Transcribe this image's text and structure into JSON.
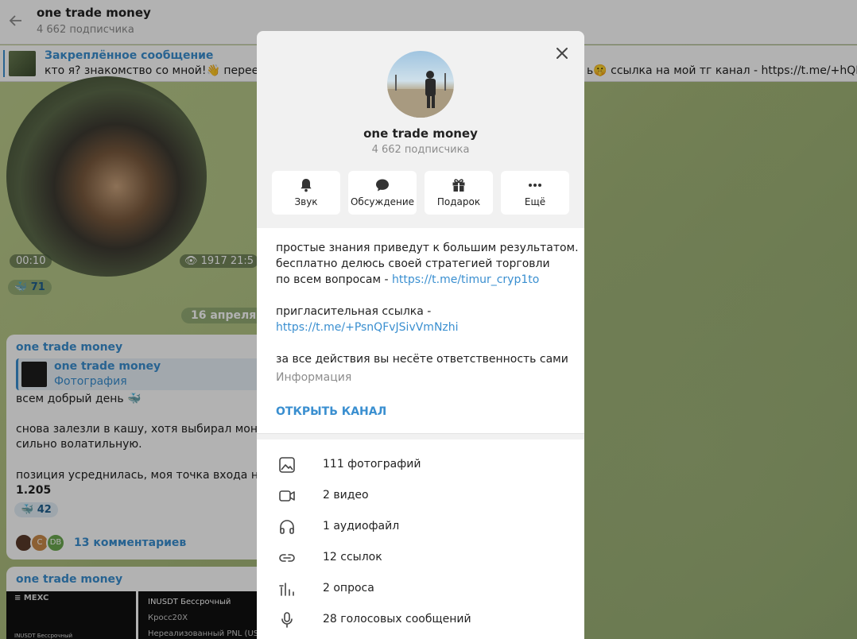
{
  "header": {
    "title": "one trade money",
    "subtitle": "4 662 подписчика"
  },
  "pinned": {
    "title": "Закреплённое сообщение",
    "text": "кто я? знакомство со мной!👋  переезд",
    "text_right": "ь🤫  ссылка на мой тг канал - https://t.me/+hQPxS"
  },
  "chat": {
    "video_time": "00:10",
    "video_views": "👁 1917  21:5",
    "reaction_1": "🐳 71",
    "date_pill": "16 апреля",
    "post1": {
      "author": "one trade money",
      "repost_title": "one trade money",
      "repost_sub": "Фотография",
      "line1": "всем добрый день 🐳",
      "line2": "снова залезли в кашу, хотя выбирал монету",
      "line3": "сильно волатильную.",
      "line4": "позиция усреднилась, моя точка входа на д",
      "line5": "1.205",
      "reaction": "🐳 42",
      "comments": "13 комментариев",
      "avatar2": "С",
      "avatar3": "DB"
    },
    "post2": {
      "author": "one trade money",
      "tile1_brand": "≡ MEXC",
      "tile1_bottom": "INUSDT Бессрочный",
      "tile2_title": "INUSDT Бессрочный",
      "tile2_sub": "Кросс20X",
      "tile2_bottom": "Нереализованный PNL (USDT)"
    }
  },
  "modal": {
    "title": "one trade money",
    "subtitle": "4 662 подписчика",
    "actions": [
      {
        "label": "Звук",
        "icon": "bell-icon"
      },
      {
        "label": "Обсуждение",
        "icon": "chat-bubble-icon"
      },
      {
        "label": "Подарок",
        "icon": "gift-icon"
      },
      {
        "label": "Ещё",
        "icon": "more-dots-icon"
      }
    ],
    "about": {
      "line1": "простые знания приведут к большим результатом.",
      "line2": "бесплатно делюсь своей стратегией торговли",
      "line3_prefix": "по всем вопросам - ",
      "line3_link": "https://t.me/timur_cryp1to",
      "line4": "пригласительная ссылка -",
      "line5_link": "https://t.me/+PsnQFvJSivVmNzhi",
      "line6": "за все действия вы несёте ответственность сами",
      "label": "Информация"
    },
    "open_channel": "ОТКРЫТЬ КАНАЛ",
    "media": [
      {
        "label": "111 фотографий",
        "icon": "photo-icon"
      },
      {
        "label": "2 видео",
        "icon": "video-icon"
      },
      {
        "label": "1 аудиофайл",
        "icon": "headphones-icon"
      },
      {
        "label": "12 ссылок",
        "icon": "link-icon"
      },
      {
        "label": "2 опроса",
        "icon": "poll-icon"
      },
      {
        "label": "28 голосовых сообщений",
        "icon": "microphone-icon"
      }
    ]
  },
  "colors": {
    "accent": "#3a8fd0",
    "text": "#222222",
    "muted": "#8c8c8c"
  }
}
